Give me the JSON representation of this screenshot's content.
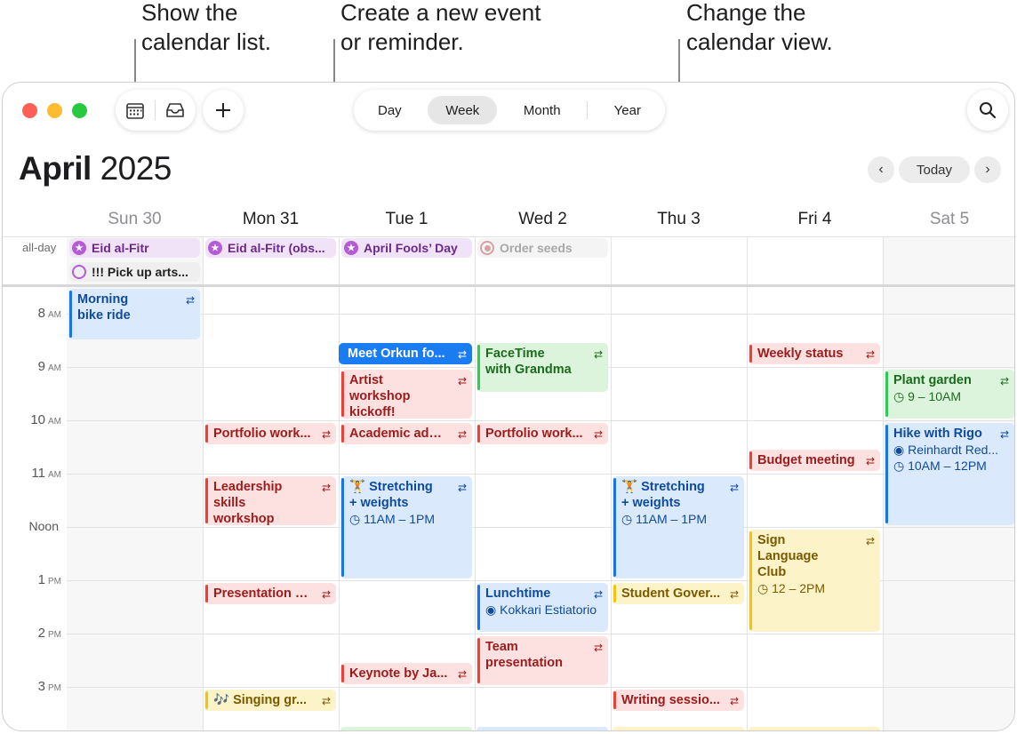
{
  "callouts": {
    "list": [
      "Show the",
      "calendar list."
    ],
    "create": [
      "Create a new event",
      "or reminder."
    ],
    "view": [
      "Change the",
      "calendar view."
    ]
  },
  "toolbar": {
    "views": [
      "Day",
      "Week",
      "Month",
      "Year"
    ],
    "active_view": "Week",
    "today_label": "Today",
    "prev_icon": "chevron-left-icon",
    "next_icon": "chevron-right-icon"
  },
  "header": {
    "month": "April",
    "year": "2025"
  },
  "days": [
    "Sun 30",
    "Mon 31",
    "Tue 1",
    "Wed 2",
    "Thu 3",
    "Fri 4",
    "Sat 5"
  ],
  "allday_label": "all-day",
  "allday": [
    {
      "title": "Eid al-Fitr",
      "color": "purple"
    },
    {
      "title": "!!! Pick up arts...",
      "color": "purple-outline"
    },
    {
      "title": "Eid al-Fitr (obs...",
      "color": "purple"
    },
    {
      "title": "April Fools’ Day",
      "color": "purple"
    },
    {
      "title": "Order seeds",
      "color": "gray"
    }
  ],
  "hours": [
    {
      "num": "8",
      "ampm": "AM"
    },
    {
      "num": "9",
      "ampm": "AM"
    },
    {
      "num": "10",
      "ampm": "AM"
    },
    {
      "num": "11",
      "ampm": "AM"
    },
    {
      "num": "Noon",
      "ampm": ""
    },
    {
      "num": "1",
      "ampm": "PM"
    },
    {
      "num": "2",
      "ampm": "PM"
    },
    {
      "num": "3",
      "ampm": "PM"
    }
  ],
  "events": [
    {
      "title": "Morning bike ride"
    },
    {
      "title": "Portfolio work..."
    },
    {
      "title": "Leadership skills workshop"
    },
    {
      "title": "Presentation p..."
    },
    {
      "title": "🎶 Singing gr..."
    },
    {
      "title": "Meet Orkun fo..."
    },
    {
      "title": "Artist workshop kickoff!"
    },
    {
      "title": "Academic advi..."
    },
    {
      "title": "🏋️ Stretching + weights",
      "time": "11AM – 1PM"
    },
    {
      "title": "Keynote by Ja..."
    },
    {
      "title": "FaceTime with Grandma"
    },
    {
      "title": "Portfolio work..."
    },
    {
      "title": "Lunchtime",
      "location": "Kokkari Estiatorio"
    },
    {
      "title": "Team presentation"
    },
    {
      "title": "🏋️ Stretching + weights",
      "time": "11AM – 1PM"
    },
    {
      "title": "Student Gover..."
    },
    {
      "title": "Writing sessio..."
    },
    {
      "title": "Weekly status"
    },
    {
      "title": "Budget meeting"
    },
    {
      "title": "Sign Language Club",
      "time": "12 – 2PM"
    },
    {
      "title": "Plant garden",
      "time": "9 – 10AM"
    },
    {
      "title": "Hike with Rigo",
      "location": "Reinhardt Red...",
      "time": "10AM – 12PM"
    }
  ]
}
